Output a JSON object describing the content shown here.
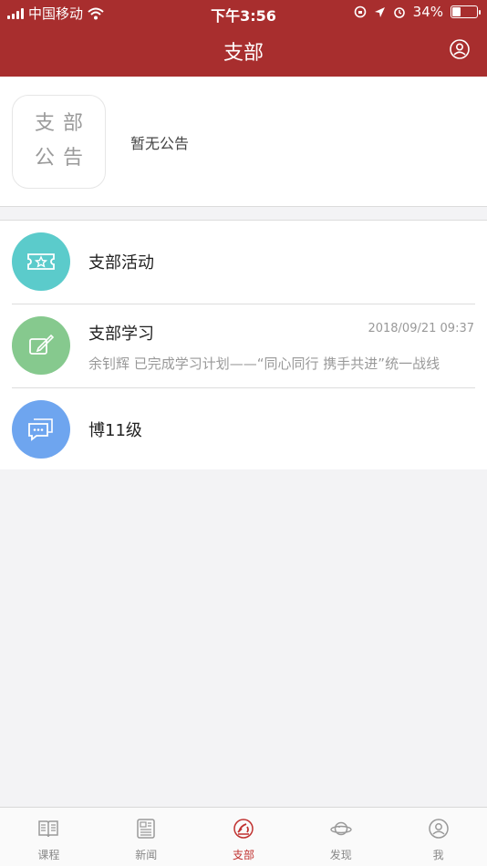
{
  "status_bar": {
    "carrier": "中国移动",
    "time": "下午3:56",
    "battery_percent": "34%",
    "battery_level": 0.34
  },
  "nav": {
    "title": "支部"
  },
  "notice": {
    "badge_line1": "支部",
    "badge_line2": "公告",
    "text": "暂无公告"
  },
  "items": [
    {
      "name": "支部活动",
      "icon": "ticket-icon",
      "color": "#5bcbcb"
    },
    {
      "name": "支部学习",
      "icon": "edit-icon",
      "color": "#86c98e",
      "time": "2018/09/21 09:37",
      "preview": "余钊辉 已完成学习计划——“同心同行 携手共进”统一战线"
    },
    {
      "name": "博11级",
      "icon": "chat-icon",
      "color": "#6ea5ef"
    }
  ],
  "tabs": [
    {
      "label": "课程",
      "icon": "book-icon",
      "active": false
    },
    {
      "label": "新闻",
      "icon": "newspaper-icon",
      "active": false
    },
    {
      "label": "支部",
      "icon": "party-emblem-icon",
      "active": true
    },
    {
      "label": "发现",
      "icon": "planet-icon",
      "active": false
    },
    {
      "label": "我",
      "icon": "user-icon",
      "active": false
    }
  ],
  "colors": {
    "brand": "#a82e2e",
    "active_tab": "#c0312f"
  }
}
